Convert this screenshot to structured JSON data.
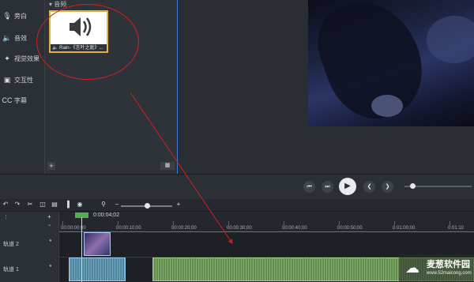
{
  "sidebar": {
    "items": [
      {
        "icon": "mic-icon",
        "label": "旁白"
      },
      {
        "icon": "speaker-icon",
        "label": "音效"
      },
      {
        "icon": "wand-icon",
        "label": "视觉效果"
      },
      {
        "icon": "interactive-icon",
        "label": "交互性"
      },
      {
        "icon": "cc-icon",
        "label": "字幕"
      }
    ]
  },
  "media_bin": {
    "section_label": "音频",
    "clip_label": "Rain-《言叶之庭》..."
  },
  "timeline": {
    "playhead_time": "0:00:04;02",
    "ticks": [
      "00:00:00;00",
      "00:00:10;00",
      "00:00:20;00",
      "00:00:30;00",
      "00:00:40;00",
      "00:00:50;00",
      "0:01:00;00",
      "0:01:10"
    ],
    "tracks": [
      {
        "name": "轨道 2"
      },
      {
        "name": "轨道 1"
      }
    ]
  },
  "watermark": {
    "text": "麦葱软件园",
    "url": "www.52maicong.com"
  },
  "colors": {
    "accent": "#3a7bd5",
    "selection": "#e0b341",
    "annotation": "#d21f1f",
    "audio_clip": "#5f8f4a"
  }
}
